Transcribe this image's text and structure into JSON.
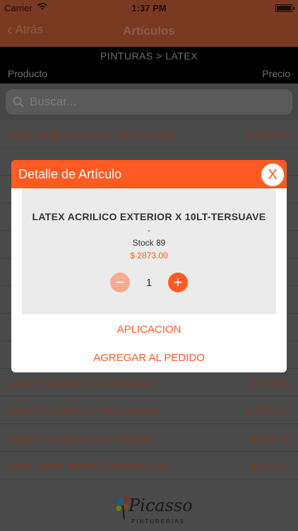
{
  "status_bar": {
    "carrier": "Carrier",
    "time": "1:37 PM"
  },
  "navbar": {
    "back_label": "Atrás",
    "title": "Artículos"
  },
  "breadcrumb": "PINTURAS > LATEX",
  "columns": {
    "product": "Producto",
    "price": "Precio"
  },
  "search": {
    "placeholder": "Buscar..."
  },
  "rows": [
    {
      "name": "Latex Acrilico Exterior  X 10Lt-Tersuave",
      "price": "$ 2873.00"
    },
    {
      "name": "",
      "price": ""
    },
    {
      "name": "",
      "price": ""
    },
    {
      "name": "",
      "price": ""
    },
    {
      "name": "",
      "price": ""
    },
    {
      "name": "",
      "price": ""
    },
    {
      "name": "",
      "price": ""
    },
    {
      "name": "",
      "price": ""
    },
    {
      "name": "",
      "price": ""
    },
    {
      "name": "Latex Profesional X 1Lt-Tersuave",
      "price": "$ 279.00"
    },
    {
      "name": "Latex Profesional X 20Lt-Tersuave",
      "price": "$ 3412.00"
    },
    {
      "name": "Latex Profesional X 4Lt-Tersuave",
      "price": "$ 882.00"
    },
    {
      "name": "Latex Tersen Blanco (Satinado) X 1Lt",
      "price": "$ 524.00"
    }
  ],
  "logo": {
    "word": "Picasso",
    "sub": "PINTURERIAS"
  },
  "modal": {
    "title": "Detalle de Artículo",
    "close_label": "X",
    "product_name": "LATEX ACRILICO EXTERIOR  X 10LT-TERSUAVE",
    "dash": "-",
    "stock": "Stock 89",
    "price": "$ 2873.00",
    "quantity": "1",
    "minus_label": "−",
    "plus_label": "+",
    "aplicacion_label": "APLICACION",
    "agregar_label": "AGREGAR AL PEDIDO"
  },
  "colors": {
    "accent": "#ff5a23",
    "overlay": "#4a4a4a"
  }
}
